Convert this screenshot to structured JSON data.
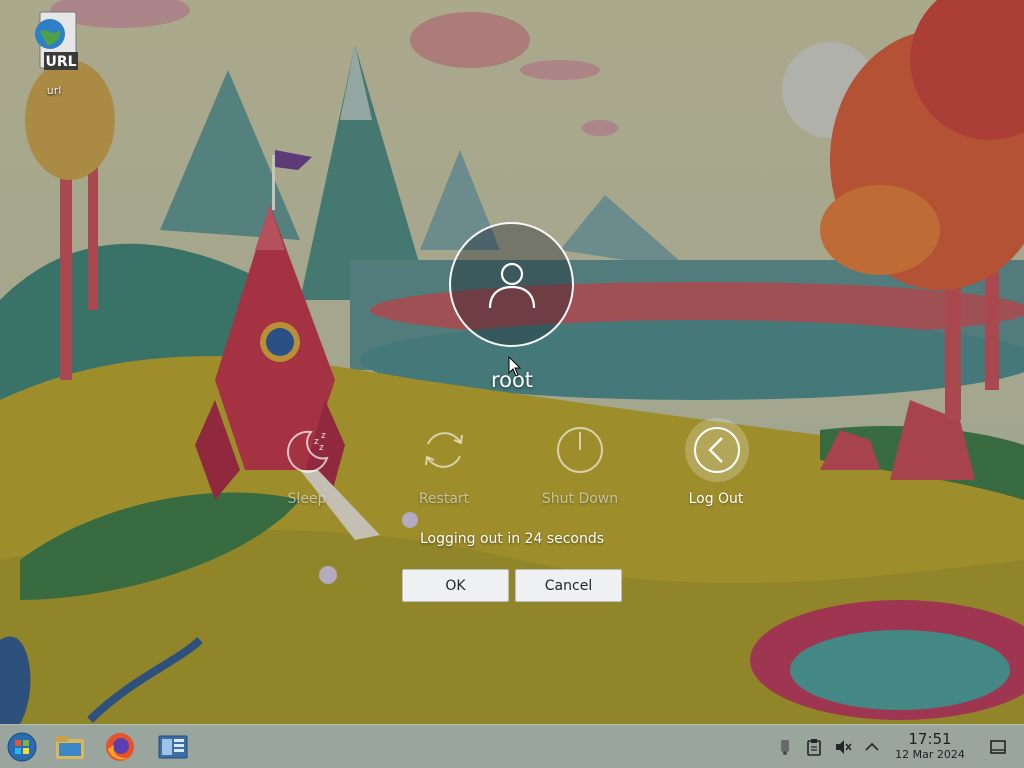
{
  "desktop": {
    "icons": [
      {
        "badge": "URL",
        "label": "url",
        "icon": "globe-document-icon"
      }
    ]
  },
  "logout_dialog": {
    "user": {
      "name": "root",
      "avatar_icon": "user-icon"
    },
    "actions": [
      {
        "label": "Sleep",
        "icon": "sleep-icon",
        "selected": false
      },
      {
        "label": "Restart",
        "icon": "restart-icon",
        "selected": false
      },
      {
        "label": "Shut Down",
        "icon": "power-icon",
        "selected": false
      },
      {
        "label": "Log Out",
        "icon": "logout-icon",
        "selected": true
      }
    ],
    "countdown_text": "Logging out in 24 seconds",
    "ok_label": "OK",
    "cancel_label": "Cancel"
  },
  "taskbar": {
    "launchers": [
      {
        "icon": "start-menu-icon"
      },
      {
        "icon": "file-manager-icon"
      },
      {
        "icon": "firefox-icon"
      },
      {
        "icon": "system-settings-icon"
      }
    ],
    "tray": [
      {
        "icon": "notifications-icon"
      },
      {
        "icon": "clipboard-icon"
      },
      {
        "icon": "volume-muted-icon"
      },
      {
        "icon": "chevron-up-icon"
      }
    ],
    "clock": {
      "time": "17:51",
      "date": "12 Mar 2024"
    },
    "show_desktop_icon": "show-desktop-icon"
  },
  "colors": {
    "accent": "#eff0f1",
    "taskbar": "#9aa59d",
    "text_light": "#ffffff"
  }
}
